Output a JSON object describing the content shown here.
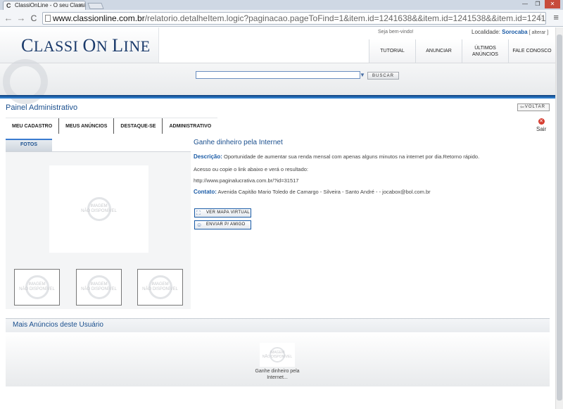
{
  "browser": {
    "tab_title": "ClassiOnLine - O seu ClassiFi",
    "tab_close": "×",
    "url_host": "www.classionline.com.br",
    "url_path": "/relatorio.detalheItem.logic?paginacao.pageToFind=1&item.id=1241638&&item.id=1241538&&item.id=1241548&&item.id=1241",
    "back_icon": "←",
    "forward_icon": "→",
    "reload_icon": "C",
    "star_icon": "☆",
    "wrench_icon": "≡"
  },
  "header": {
    "logo_first": "C",
    "logo_rest1": "LASSI ",
    "logo_second": "O",
    "logo_rest2": "N ",
    "logo_third": "L",
    "logo_rest3": "INE",
    "welcome": "Seja bem-vindo!",
    "locality_label": "Localidade: ",
    "locality_city": "Sorocaba",
    "locality_change": " [ alterar ]",
    "menu": [
      "TUTORIAL",
      "ANUNCIAR",
      "ÚLTIMOS ANÚNCIOS",
      "FALE CONOSCO"
    ]
  },
  "search": {
    "button": "BUSCAR"
  },
  "panel": {
    "title": "Painel Administrativo",
    "back_button": "VOLTAR",
    "tabs": [
      "MEU CADASTRO",
      "MEUS ANÚNCIOS",
      "DESTAQUE-SE",
      "ADMINISTRATIVO"
    ],
    "logout": "Sair"
  },
  "photos": {
    "tab_label": "FOTOS",
    "no_image_line1": "IMAGEM",
    "no_image_line2": "NÃO DISPONÍVEL"
  },
  "ad": {
    "title": "Ganhe dinheiro pela Internet",
    "description_label": "Descrição:",
    "description": " Oportunidade de aumentar sua renda mensal com apenas alguns minutos na internet por dia.Retorno rápido.",
    "line2": "Acesso ou copie o link abaixo e verá o resultado:",
    "link": "http://www.paginalucrativa.com.br/?id=31517",
    "contact_label": "Contato:",
    "contact": " Avenida Capitão Mario Toledo de Camargo - Silveira - Santo André - - jocabox@bol.com.br",
    "map_button": "VER MAPA VIRTUAL",
    "send_button": "ENVIAR P/ AMIGO"
  },
  "more": {
    "title": "Mais Anúncios deste Usuário",
    "item_caption": "Ganhe dinheiro pela Internet..."
  }
}
